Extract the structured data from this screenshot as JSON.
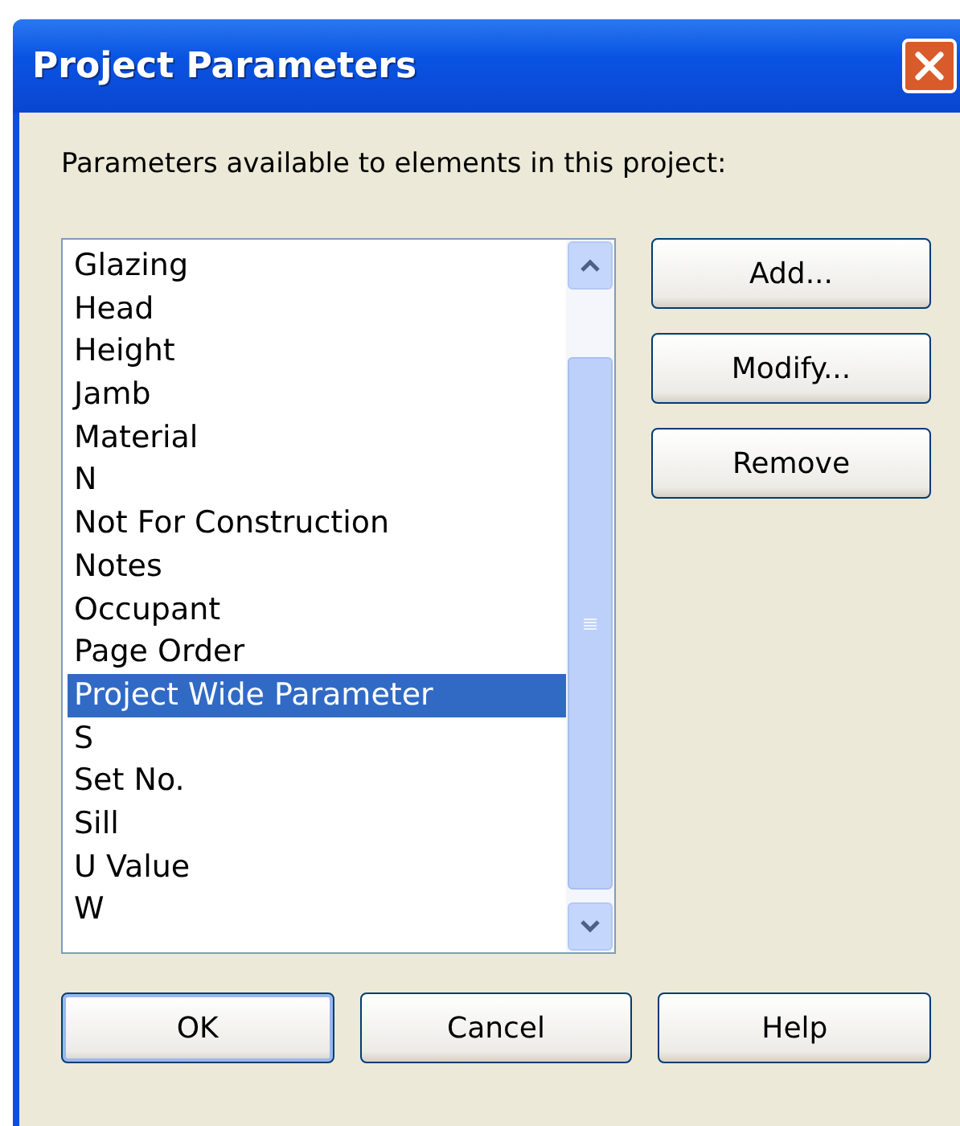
{
  "window": {
    "title": "Project Parameters"
  },
  "prompt": "Parameters available to elements in this project:",
  "parameters": [
    {
      "label": "Glazing",
      "selected": false
    },
    {
      "label": "Head",
      "selected": false
    },
    {
      "label": "Height",
      "selected": false
    },
    {
      "label": "Jamb",
      "selected": false
    },
    {
      "label": "Material",
      "selected": false
    },
    {
      "label": "N",
      "selected": false
    },
    {
      "label": "Not For Construction",
      "selected": false
    },
    {
      "label": "Notes",
      "selected": false
    },
    {
      "label": "Occupant",
      "selected": false
    },
    {
      "label": "Page Order",
      "selected": false
    },
    {
      "label": "Project Wide Parameter",
      "selected": true
    },
    {
      "label": "S",
      "selected": false
    },
    {
      "label": "Set No.",
      "selected": false
    },
    {
      "label": "Sill",
      "selected": false
    },
    {
      "label": "U Value",
      "selected": false
    },
    {
      "label": "W",
      "selected": false
    }
  ],
  "side_buttons": [
    "Add...",
    "Modify...",
    "Remove"
  ],
  "bottom_buttons": [
    {
      "label": "OK",
      "default": true
    },
    {
      "label": "Cancel",
      "default": false
    },
    {
      "label": "Help",
      "default": false
    }
  ]
}
